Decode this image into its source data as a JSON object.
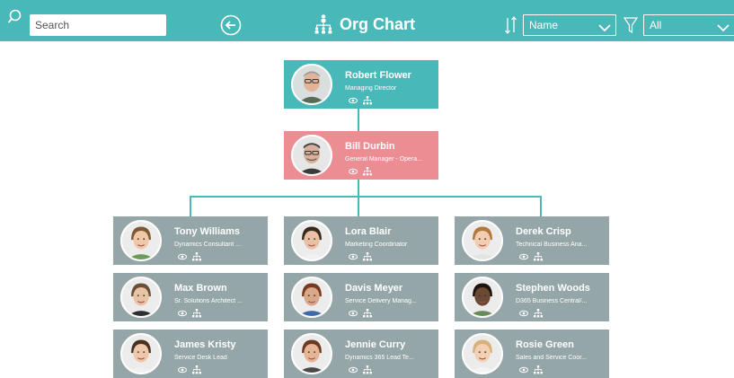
{
  "header": {
    "search_placeholder": "Search",
    "title": "Org Chart",
    "sort_value": "Name",
    "filter_value": "All"
  },
  "colors": {
    "header": "#48b8b8",
    "root_card": "#48b8b8",
    "selected_card": "#ec8d94",
    "card": "#95a6a8"
  },
  "root": {
    "name": "Robert Flower",
    "title": "Managing Director"
  },
  "manager": {
    "name": "Bill Durbin",
    "title": "General Manager - Opera..."
  },
  "reports": [
    {
      "name": "Tony Williams",
      "title": "Dynamics Consultant ..."
    },
    {
      "name": "Lora Blair",
      "title": "Marketing Coordinator"
    },
    {
      "name": "Derek Crisp",
      "title": "Technical Business Ana..."
    },
    {
      "name": "Max Brown",
      "title": "Sr. Solutions Architect ..."
    },
    {
      "name": "Davis Meyer",
      "title": "Service Delivery Manag..."
    },
    {
      "name": "Stephen Woods",
      "title": "D365 Business Central/..."
    },
    {
      "name": "James Kristy",
      "title": "Service Desk Lead"
    },
    {
      "name": "Jennie Curry",
      "title": "Dynamics 365 Lead Te..."
    },
    {
      "name": "Rosie Green",
      "title": "Sales and Service Coor..."
    }
  ]
}
